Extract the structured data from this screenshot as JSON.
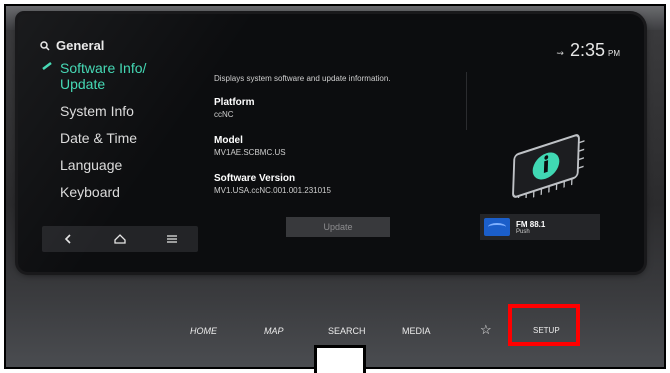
{
  "menu": {
    "header": "General",
    "items": [
      {
        "label_line1": "Software Info/",
        "label_line2": "Update"
      },
      {
        "label": "System Info"
      },
      {
        "label": "Date & Time"
      },
      {
        "label": "Language"
      },
      {
        "label": "Keyboard"
      }
    ]
  },
  "content": {
    "description": "Displays system software and update information.",
    "platform_title": "Platform",
    "platform_value": "ccNC",
    "model_title": "Model",
    "model_value": "MV1AE.SCBMC.US",
    "sw_title": "Software Version",
    "sw_value": "MV1.USA.ccNC.001.001.231015",
    "update_label": "Update"
  },
  "status": {
    "time": "2:35",
    "ampm": "PM"
  },
  "radio": {
    "station": "FM 88.1",
    "action": "Push"
  },
  "hardware_buttons": {
    "home": "HOME",
    "map": "MAP",
    "search": "SEARCH",
    "media": "MEDIA",
    "setup": "SETUP"
  },
  "colors": {
    "accent": "#40d8b3",
    "highlight": "#ff0000"
  }
}
